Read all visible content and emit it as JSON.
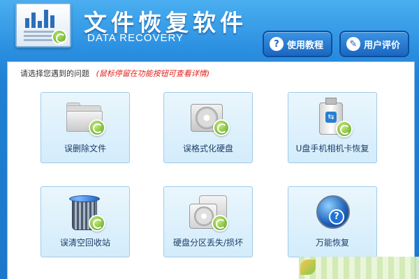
{
  "header": {
    "title": "文件恢复软件",
    "subtitle": "DATA RECOVERY",
    "buttons": {
      "tutorial_label": "使用教程",
      "review_label": "用户评价"
    }
  },
  "main": {
    "prompt": "请选择您遇到的问题",
    "hint": "(鼠标停留在功能按钮可查看详情)",
    "tiles": [
      {
        "label": "误删除文件",
        "icon": "folder-icon"
      },
      {
        "label": "误格式化硬盘",
        "icon": "hard-disk-icon"
      },
      {
        "label": "U盘手机相机卡恢复",
        "icon": "usb-drive-icon"
      },
      {
        "label": "误清空回收站",
        "icon": "recycle-bin-icon"
      },
      {
        "label": "硬盘分区丢失/损坏",
        "icon": "partition-disks-icon"
      },
      {
        "label": "万能恢复",
        "icon": "universal-recovery-icon"
      }
    ]
  },
  "colors": {
    "header_blue": "#2b8fe0",
    "tile_bg": "#d3ecfb",
    "hint_red": "#e0201a",
    "recover_green": "#58a21c"
  }
}
